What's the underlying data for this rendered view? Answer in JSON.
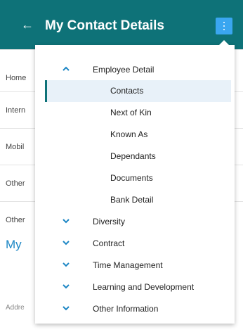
{
  "header": {
    "title": "My Contact Details",
    "back_icon": "←"
  },
  "background": {
    "rows": [
      "Home",
      "Intern",
      "Mobil",
      "Other",
      "Other"
    ],
    "section_heading": "My",
    "address_label": "Addre"
  },
  "menu": {
    "employee_detail": {
      "label": "Employee Detail",
      "icon": "chevron-up-icon",
      "expanded": true
    },
    "subitems": [
      "Contacts",
      "Next of Kin",
      "Known As",
      "Dependants",
      "Documents",
      "Bank Detail"
    ],
    "selected_subitem": "Contacts",
    "sections": [
      "Diversity",
      "Contract",
      "Time Management",
      "Learning and Development",
      "Other Information"
    ]
  }
}
